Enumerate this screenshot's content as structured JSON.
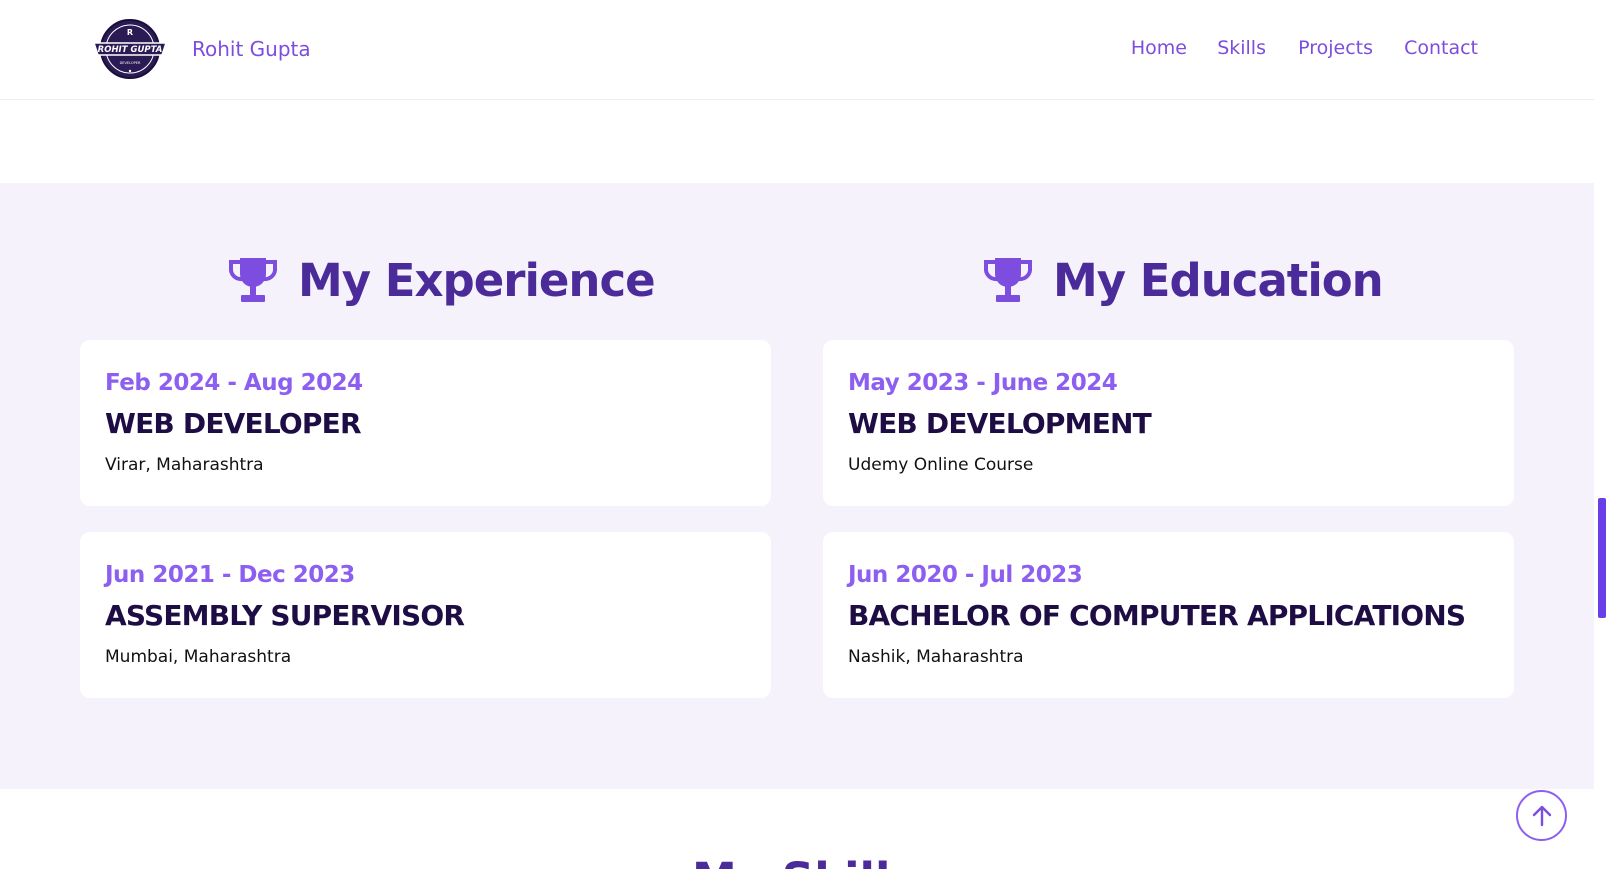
{
  "header": {
    "brand_name": "Rohit Gupta",
    "logo_text": "ROHIT GUPTA",
    "nav": [
      "Home",
      "Skills",
      "Projects",
      "Contact"
    ]
  },
  "experience": {
    "title": "My Experience",
    "items": [
      {
        "date": "Feb 2024 - Aug 2024",
        "role": "WEB DEVELOPER",
        "place": "Virar, Maharashtra"
      },
      {
        "date": "Jun 2021 - Dec 2023",
        "role": "ASSEMBLY SUPERVISOR",
        "place": "Mumbai, Maharashtra"
      }
    ]
  },
  "education": {
    "title": "My Education",
    "items": [
      {
        "date": "May 2023 - June 2024",
        "role": "WEB DEVELOPMENT",
        "place": "Udemy Online Course"
      },
      {
        "date": "Jun 2020 - Jul 2023",
        "role": "BACHELOR OF COMPUTER APPLICATIONS",
        "place": "Nashik, Maharashtra"
      }
    ]
  },
  "next_section": {
    "title_partial": "My Skills"
  },
  "colors": {
    "accent": "#7c4ddf",
    "heading": "#4b2a99",
    "dark": "#1e0d45",
    "section_bg": "#f5f2fb"
  },
  "icons": {
    "section": "trophy-icon",
    "scroll": "arrow-up-icon"
  }
}
